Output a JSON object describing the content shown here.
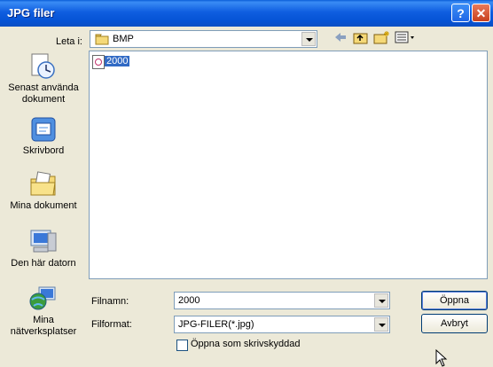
{
  "window": {
    "title": "JPG filer"
  },
  "look_in": {
    "label": "Leta i:",
    "value": "BMP"
  },
  "places": [
    {
      "label_line1": "Senast använda",
      "label_line2": "dokument",
      "icon": "recent-documents-icon"
    },
    {
      "label_line1": "Skrivbord",
      "label_line2": "",
      "icon": "desktop-icon"
    },
    {
      "label_line1": "Mina dokument",
      "label_line2": "",
      "icon": "my-documents-icon"
    },
    {
      "label_line1": "Den här datorn",
      "label_line2": "",
      "icon": "my-computer-icon"
    },
    {
      "label_line1": "Mina",
      "label_line2": "nätverksplatser",
      "icon": "network-places-icon"
    }
  ],
  "files": [
    {
      "name": "2000"
    }
  ],
  "filename": {
    "label": "Filnamn:",
    "value": "2000"
  },
  "filetype": {
    "label": "Filformat:",
    "value": "JPG-FILER(*.jpg)"
  },
  "readonly": {
    "label": "Öppna som skrivskyddad"
  },
  "buttons": {
    "open": "Öppna",
    "cancel": "Avbryt"
  },
  "colors": {
    "title_bar": "#0552d4",
    "selection": "#316ac5",
    "dialog_bg": "#ece9d8"
  }
}
